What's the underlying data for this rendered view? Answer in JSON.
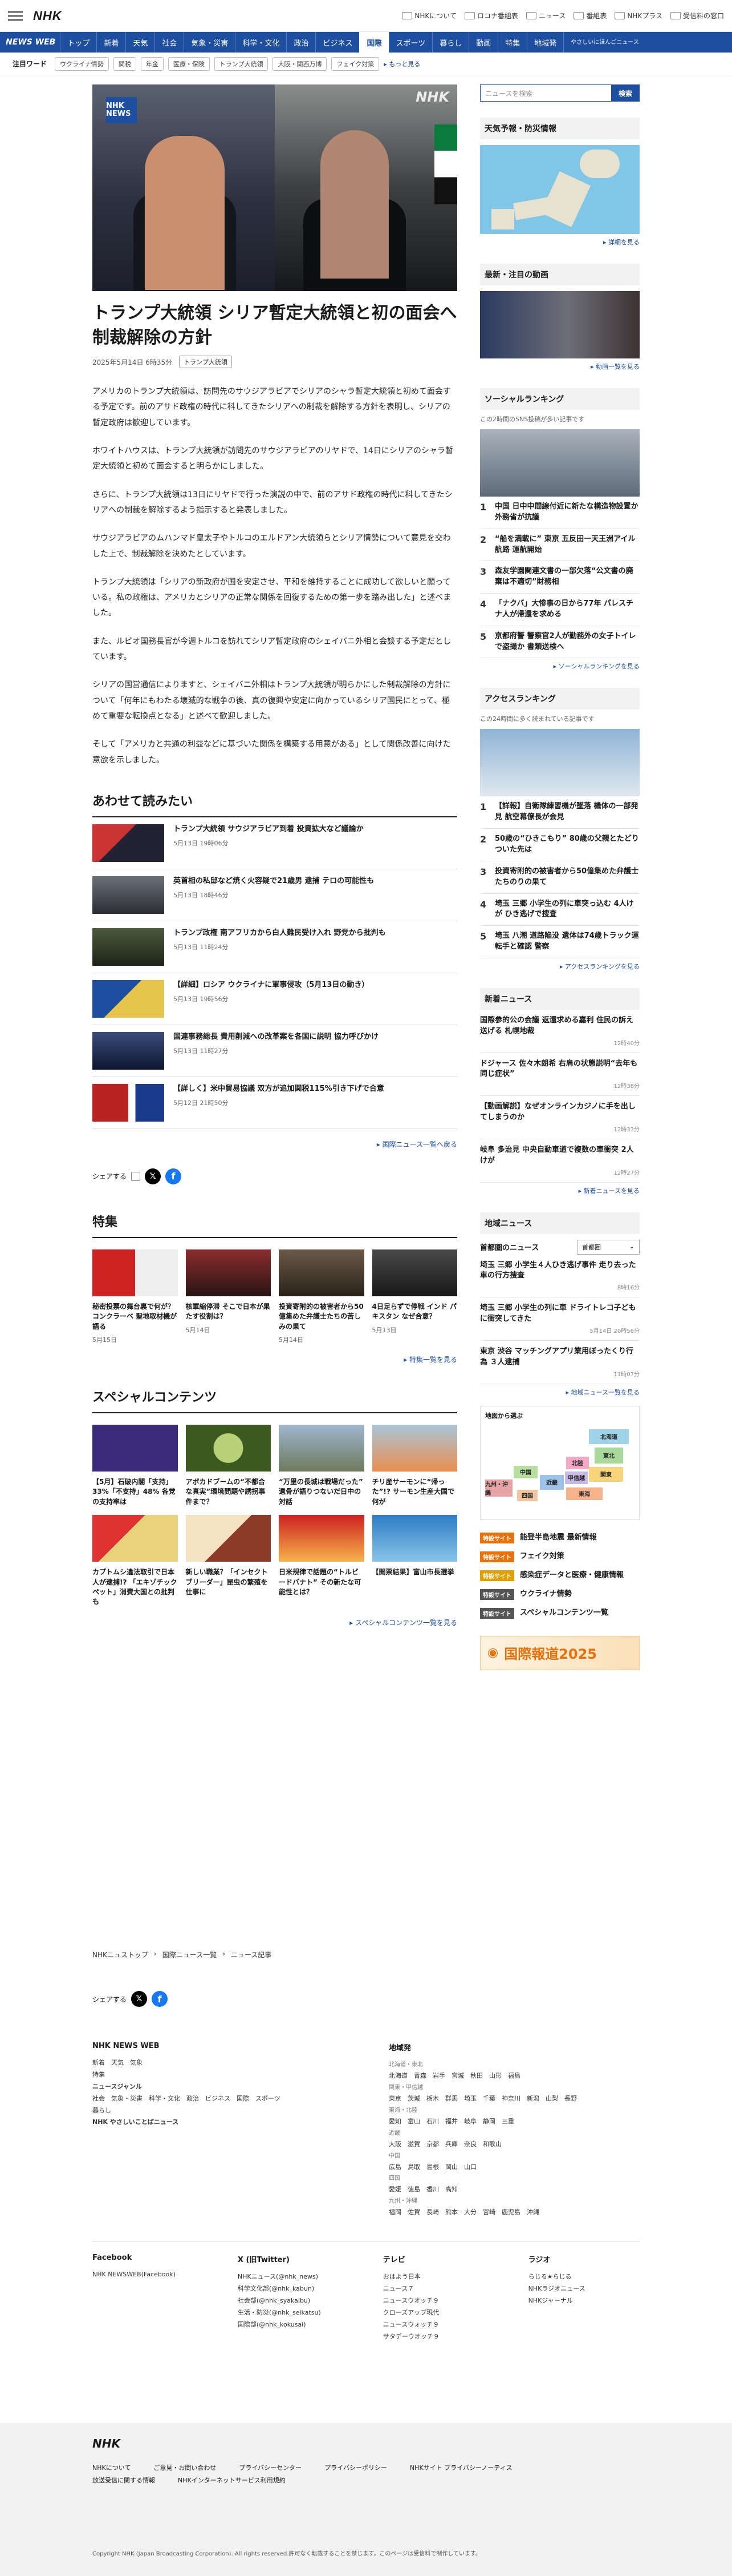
{
  "header": {
    "logo": "NHK",
    "links": [
      "NHKについて",
      "ロコナ番組表",
      "ニュース",
      "番組表",
      "NHKプラス",
      "受信料の窓口"
    ]
  },
  "nav": {
    "brand": "NEWS WEB",
    "items": [
      "トップ",
      "新着",
      "天気",
      "社会",
      "気象・災害",
      "科学・文化",
      "政治",
      "ビジネス",
      "国際",
      "スポーツ",
      "暮らし",
      "動画",
      "特集",
      "地域発",
      "やさしいにほんごニュース"
    ],
    "active": "国際"
  },
  "keywords": {
    "label": "注目ワード",
    "items": [
      "ウクライナ情勢",
      "関税",
      "年金",
      "医療・保険",
      "トランプ大統領",
      "大阪・関西万博",
      "フェイク対策"
    ],
    "more": "もっと見る"
  },
  "hero": {
    "badge": "NHK NEWS",
    "mark": "NHK"
  },
  "article": {
    "title": "トランプ大統領 シリア暫定大統領と初の面会へ 制裁解除の方針",
    "date": "2025年5月14日 6時35分",
    "tag": "トランプ大統領",
    "paragraphs": [
      "アメリカのトランプ大統領は、訪問先のサウジアラビアでシリアのシャラ暫定大統領と初めて面会する予定です。前のアサド政権の時代に科してきたシリアへの制裁を解除する方針を表明し、シリアの暫定政府は歓迎しています。",
      "ホワイトハウスは、トランプ大統領が訪問先のサウジアラビアのリヤドで、14日にシリアのシャラ暫定大統領と初めて面会すると明らかにしました。",
      "さらに、トランプ大統領は13日にリヤドで行った演説の中で、前のアサド政権の時代に科してきたシリアへの制裁を解除するよう指示すると発表しました。",
      "サウジアラビアのムハンマド皇太子やトルコのエルドアン大統領らとシリア情勢について意見を交わした上で、制裁解除を決めたとしています。",
      "トランプ大統領は「シリアの新政府が国を安定させ、平和を維持することに成功して欲しいと願っている。私の政権は、アメリカとシリアの正常な関係を回復するための第一歩を踏み出した」と述べました。",
      "また、ルビオ国務長官が今週トルコを訪れてシリア暫定政府のシェイバニ外相と会談する予定だとしています。",
      "シリアの国営通信によりますと、シェイバニ外相はトランプ大統領が明らかにした制裁解除の方針について「何年にもわたる壊滅的な戦争の後、真の復興や安定に向かっているシリア国民にとって、極めて重要な転換点となる」と述べて歓迎しました。",
      "そして「アメリカと共通の利益などに基づいた関係を構築する用意がある」として関係改善に向けた意欲を示しました。"
    ]
  },
  "related": {
    "heading": "あわせて読みたい",
    "items": [
      {
        "title": "トランプ大統領 サウジアラビア到着 投資拡大など議論か",
        "date": "5月13日 19時06分"
      },
      {
        "title": "英首相の私邸など焼く火容疑で21歳男 逮捕 テロの可能性も",
        "date": "5月13日 18時46分"
      },
      {
        "title": "トランプ政権 南アフリカから白人難民受け入れ 野党から批判も",
        "date": "5月13日 11時24分"
      },
      {
        "title": "【詳細】ロシア ウクライナに軍事侵攻（5月13日の動き）",
        "date": "5月13日 19時56分"
      },
      {
        "title": "国連事務総長 費用削減への改革案を各国に説明 協力呼びかけ",
        "date": "5月13日 11時27分"
      },
      {
        "title": "【詳しく】米中貿易協議 双方が追加関税115%引き下げで合意",
        "date": "5月12日 21時50分"
      }
    ],
    "more": "国際ニュース一覧へ戻る"
  },
  "share": {
    "label": "シェアする"
  },
  "features": {
    "heading": "特集",
    "items": [
      {
        "title": "秘密投票の舞台裏で何が？ コンクラーベ 聖地取材機が語る",
        "date": "5月15日"
      },
      {
        "title": "核軍縮停滞 そこで日本が果たす役割は？",
        "date": "5月14日"
      },
      {
        "title": "投資寄附的の被害者から50億集めた弁護士たちの苦しみの果て",
        "date": "5月14日"
      },
      {
        "title": "4日足らずで停戦 インド パキスタン なぜ合意？",
        "date": "5月13日"
      }
    ],
    "more": "特集一覧を見る"
  },
  "specials": {
    "heading": "スペシャルコンテンツ",
    "items": [
      {
        "title": "【5月】石破内閣「支持」33%「不支持」48% 各党の支持率は"
      },
      {
        "title": "アボカドブームの“不都合な真実”環境問題や誘拐事件まで？"
      },
      {
        "title": "“万里の長城は戦場だった” 遺骨が語りつないだ日中の対話"
      },
      {
        "title": "チリ産サーモンに“帰った”!? サーモン生産大国で何が"
      },
      {
        "title": "カプトムシ違法取引で日本人が逮捕!? 「エキゾチックペット」消費大国との批判も"
      },
      {
        "title": "新しい職業？「インセクトブリーダー」昆虫の繁殖を仕事に"
      },
      {
        "title": "日米規律で話題の“トルビードバナト” その新たな可能性とは？"
      },
      {
        "title": "【開票結果】富山市長選挙"
      }
    ],
    "more": "スペシャルコンテンツ一覧を見る"
  },
  "breadcrumb": [
    "NHKニュストップ",
    "国際ニュース一覧",
    "ニュース記事"
  ],
  "sidebar": {
    "search_placeholder": "ニュースを検索",
    "search_button": "検索",
    "weather": {
      "heading": "天気予報・防災情報",
      "more": "詳細を見る"
    },
    "video": {
      "heading": "最新・注目の動画",
      "more": "動画一覧を見る"
    },
    "social": {
      "heading": "ソーシャルランキング",
      "sub": "この2時間のSNS投稿が多い記事です",
      "items": [
        "中国 日中中間線付近に新たな構造物設置か 外務省が抗議",
        "“船を満載に” 東京 五反田一天王洲アイル航路 運航開始",
        "森友学園関連文書の一部欠落“公文書の廃棄は不適切”財務相",
        "「ナクバ」大惨事の日から77年 パレスチナ人が帰還を求める",
        "京都府警 警察官2人が勤務外の女子トイレで盗撮か 書類送検へ"
      ],
      "more": "ソーシャルランキングを見る"
    },
    "access": {
      "heading": "アクセスランキング",
      "sub": "この24時間に多く読まれている記事です",
      "items": [
        "【詳報】自衛隊練習機が墜落 機体の一部発見 航空幕僚長が会見",
        "50歳の“ひきこもり” 80歳の父親とたどりついた先は",
        "投資寄附的の被害者から50億集めた弁護士たちのりの果て",
        "埼玉 三郷 小学生の列に車突っ込む 4人けが ひき逃げで捜査",
        "埼玉 八潮 道路陥没 遺体は74歳トラック運転手と確認 警察"
      ],
      "more": "アクセスランキングを見る"
    },
    "newarrivals": {
      "heading": "新着ニュース",
      "items": [
        {
          "title": "国際参的公の会議 返還求める嘉利 住民の訴え送げる 札幌地裁",
          "time": "12時40分"
        },
        {
          "title": "ドジャース 佐々木朗希 右肩の状態説明“去年も同じ症状”",
          "time": "12時38分"
        },
        {
          "title": "【動画解説】なぜオンラインカジノに手を出してしまうのか",
          "time": "12時33分"
        },
        {
          "title": "岐阜 多治見 中央自動車道で複数の車衝突 2人けが",
          "time": "12時27分"
        }
      ],
      "more": "新着ニュースを見る"
    },
    "regional": {
      "heading": "地域ニュース",
      "tab": "首都圏のニュース",
      "select": "首都圏",
      "items": [
        {
          "title": "埼玉 三郷 小学生４人ひき逃げ事件 走り去った車の行方捜査",
          "time": "8時16分"
        },
        {
          "title": "埼玉 三郷 小学生の列に車 ドライトレコ子どもに衝突してきた",
          "time": "5月14日 20時56分"
        },
        {
          "title": "東京 渋谷 マッチングアプリ業用ぼったくり行為 ３人逮捕",
          "time": "11時07分"
        }
      ],
      "more": "地域ニュース一覧を見る"
    },
    "prefmap": {
      "title": "地図から選ぶ",
      "regions": [
        "北海道",
        "東北",
        "関東",
        "北陸",
        "甲信越",
        "東海",
        "近畿",
        "中国",
        "四国",
        "九州・沖縄"
      ]
    },
    "specials": [
      {
        "badge": "特設サイト",
        "text": "能登半島地震 最新情報",
        "color": "#e8710a"
      },
      {
        "badge": "特設サイト",
        "text": "フェイク対策",
        "color": "#e8710a"
      },
      {
        "badge": "特設サイト",
        "text": "感染症データと医療・健康情報",
        "color": "#e0a100"
      },
      {
        "badge": "特設サイト",
        "text": "ウクライナ情勢",
        "color": "#555555"
      },
      {
        "badge": "特設サイト",
        "text": "スペシャルコンテンツ一覧",
        "color": "#555555"
      }
    ],
    "banner": "国際報道2025"
  },
  "footer": {
    "brand": "NHK NEWS WEB",
    "cols": [
      {
        "h": "NHK NEWS WEB",
        "lines": [
          "新着　天気　気象",
          "特集",
          "ニュースジャンル",
          "社会　気象・災害　科学・文化　政治　ビジネス　国際　スポーツ",
          "暮らし",
          "NHK やさしいことばニュース"
        ]
      },
      {
        "h": "地域発",
        "lines": [
          "北海道・東北",
          "北海道　青森　岩手　宮城　秋田　山形　福島",
          "関東・甲信越",
          "東京　茨城　栃木　群馬　埼玉　千葉　神奈川　新潟　山梨　長野",
          "東海・北陸",
          "愛知　富山　石川　福井　岐阜　静岡　三重",
          "近畿",
          "大阪　滋賀　京都　兵庫　奈良　和歌山",
          "中国",
          "広島　鳥取　島根　岡山　山口",
          "四国",
          "愛媛　徳島　香川　高知",
          "九州・沖縄",
          "福岡　佐賀　長崎　熊本　大分　宮崎　鹿児島　沖縄"
        ]
      }
    ],
    "social": [
      {
        "h": "Facebook",
        "lines": [
          "NHK NEWSWEB(Facebook)"
        ]
      },
      {
        "h": "X (旧Twitter)",
        "lines": [
          "NHKニュース(@nhk_news)",
          "科学文化部(@nhk_kabun)",
          "社会部(@nhk_syakaibu)",
          "生活・防災(@nhk_seikatsu)",
          "国際部(@nhk_kokusai)"
        ]
      },
      {
        "h": "テレビ",
        "lines": [
          "おはよう日本",
          "ニュース７",
          "ニュースウオッチ９",
          "クローズアップ現代",
          "ニュースウォッチ９",
          "サタデーウオッチ９"
        ]
      },
      {
        "h": "ラジオ",
        "lines": [
          "らじる★らじる",
          "NHKラジオニュース",
          "NHKジャーナル"
        ]
      }
    ],
    "bottom_links": [
      "NHKについて",
      "ご意見・お問い合わせ",
      "プライバシーセンター",
      "プライバシーポリシー",
      "NHKサイト プライバシーノーティス",
      "放送受信に関する情報",
      "NHKインターネットサービス利用規約"
    ],
    "copyright": "Copyright NHK (Japan Broadcasting Corporation). All rights reserved.許可なく転載することを禁じます。このページは受信料で制作しています。"
  }
}
